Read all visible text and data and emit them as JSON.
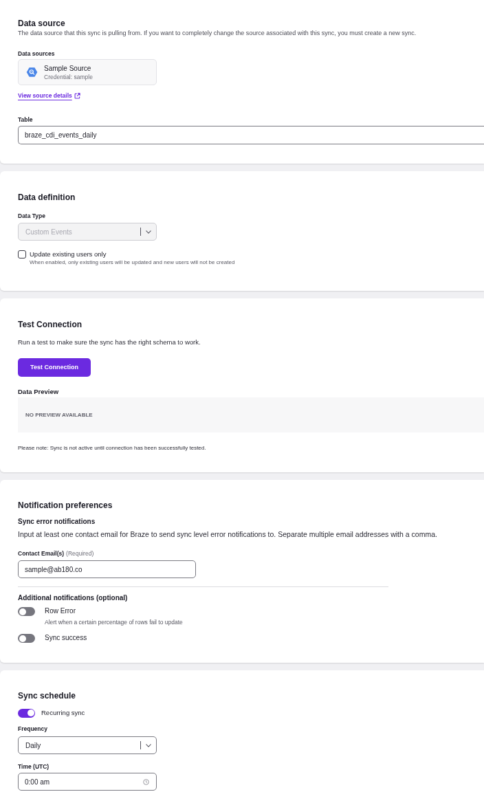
{
  "data_source": {
    "title": "Data source",
    "description": "The data source that this sync is pulling from. If you want to completely change the source associated with this sync, you must create a new sync.",
    "sources_label": "Data sources",
    "source": {
      "name": "Sample Source",
      "credential": "Credential: sample"
    },
    "details_link": "View source details",
    "table": {
      "label": "Table",
      "value": "braze_cdi_events_daily"
    }
  },
  "data_definition": {
    "title": "Data definition",
    "data_type": {
      "label": "Data Type",
      "value": "Custom Events",
      "disabled": true
    },
    "update_existing_only": {
      "label": "Update existing users only",
      "hint": "When enabled, only existing users will be updated and new users will not be created",
      "checked": false
    }
  },
  "test_connection": {
    "title": "Test Connection",
    "description": "Run a test to make sure the sync has the right schema to work.",
    "button": "Test Connection",
    "preview": {
      "label": "Data Preview",
      "message": "NO PREVIEW AVAILABLE"
    },
    "note": "Please note: Sync is not active until connection has been successfully tested."
  },
  "notification_preferences": {
    "title": "Notification preferences",
    "error_notifications": {
      "title": "Sync error notifications",
      "description": "Input at least one contact email for Braze to send sync level error notifications to. Separate multiple email addresses with a comma.",
      "email": {
        "label": "Contact Email(s)",
        "required_note": "(Required)",
        "value": "sample@ab180.co"
      }
    },
    "additional": {
      "title": "Additional notifications (optional)",
      "toggles": [
        {
          "label": "Row Error",
          "hint": "Alert when a certain percentage of rows fail to update",
          "on": false
        },
        {
          "label": "Sync success",
          "on": false
        }
      ]
    }
  },
  "sync_schedule": {
    "title": "Sync schedule",
    "recurring": {
      "label": "Recurring sync",
      "on": true
    },
    "frequency": {
      "label": "Frequency",
      "value": "Daily",
      "disabled": false
    },
    "time": {
      "label": "Time (UTC)",
      "value": "0:00 am"
    }
  }
}
